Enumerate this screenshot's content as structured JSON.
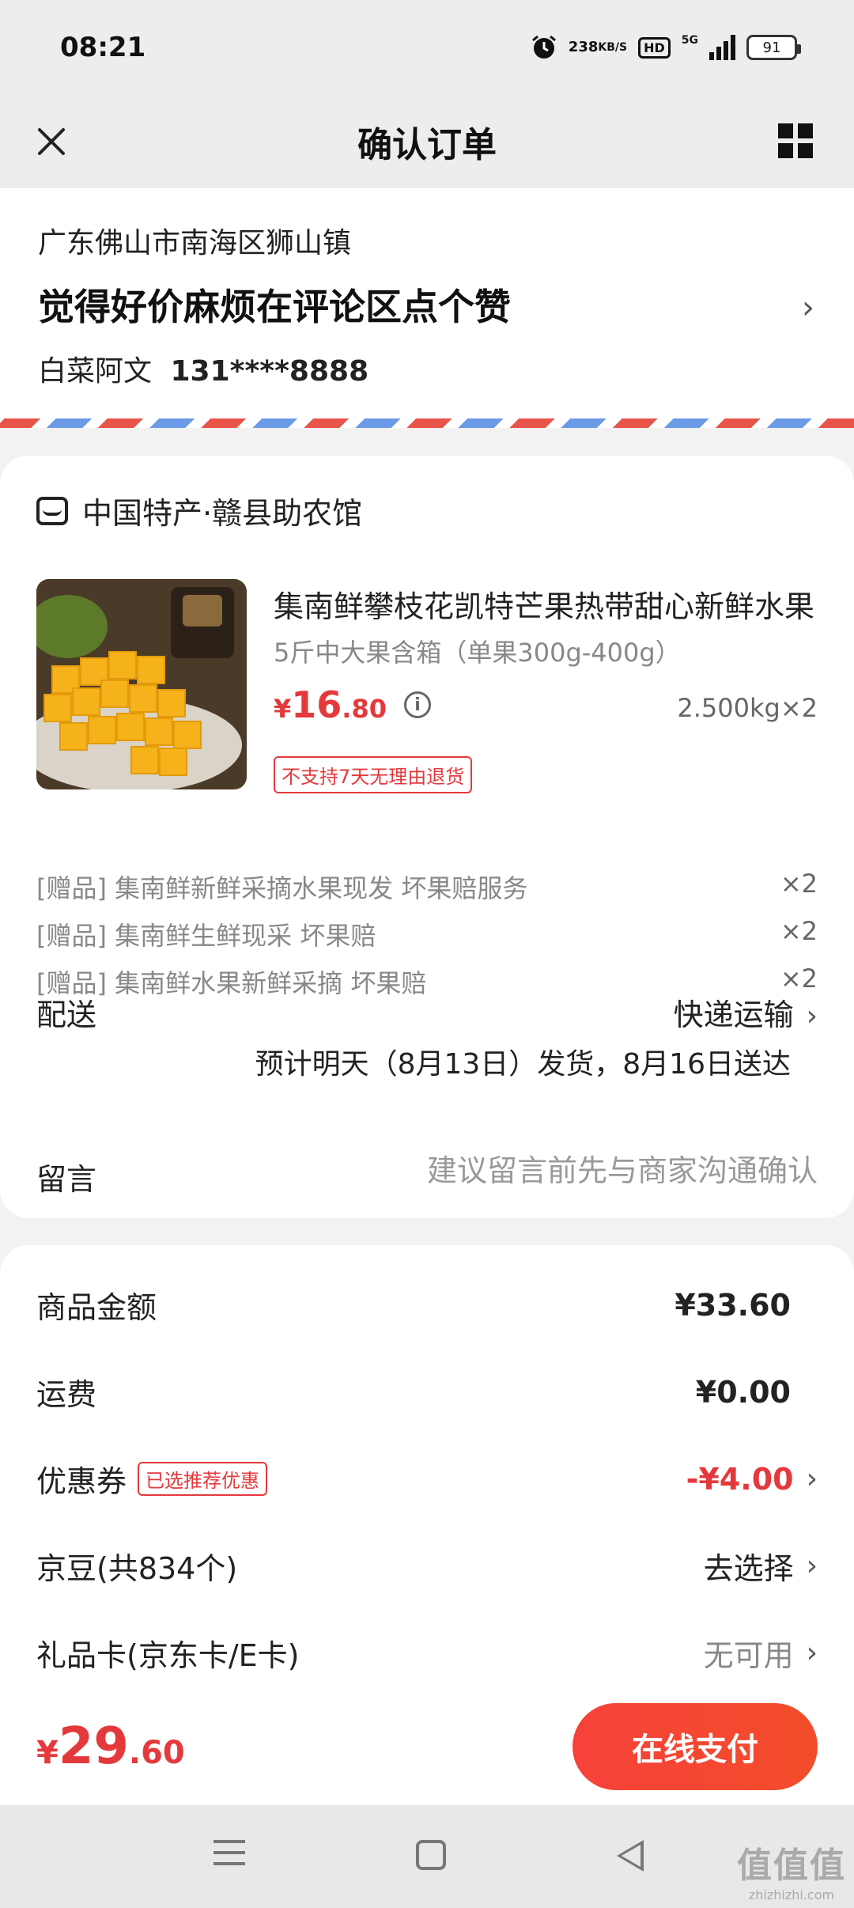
{
  "status_bar": {
    "time": "08:21",
    "net_speed_value": "238",
    "net_speed_unit": "KB/S",
    "hd": "HD",
    "network": "5G",
    "battery": "91"
  },
  "header": {
    "title": "确认订单"
  },
  "address": {
    "region": "广东佛山市南海区狮山镇",
    "detail": "觉得好价麻烦在评论区点个赞",
    "name": "白菜阿文",
    "phone": "131****8888"
  },
  "store": {
    "name": "中国特产·赣县助农馆"
  },
  "product": {
    "title": "集南鲜攀枝花凯特芒果热带甜心新鲜水果",
    "spec": "5斤中大果含箱（单果300g-400g）",
    "price_currency": "¥",
    "price_int": "16",
    "price_dec": ".80",
    "quantity": "2.500kg×2",
    "return_policy": "不支持7天无理由退货"
  },
  "gifts": [
    {
      "tag": "[赠品]",
      "name": "集南鲜新鲜采摘水果现发 坏果赔服务",
      "qty": "×2"
    },
    {
      "tag": "[赠品]",
      "name": "集南鲜生鲜现采 坏果赔",
      "qty": "×2"
    },
    {
      "tag": "[赠品]",
      "name": "集南鲜水果新鲜采摘 坏果赔",
      "qty": "×2"
    }
  ],
  "delivery": {
    "label": "配送",
    "method": "快递运输",
    "estimate": "预计明天（8月13日）发货，8月16日送达"
  },
  "note": {
    "label": "留言",
    "placeholder": "建议留言前先与商家沟通确认"
  },
  "summary": {
    "goods_label": "商品金额",
    "goods_value": "¥33.60",
    "shipping_label": "运费",
    "shipping_value": "¥0.00",
    "coupon_label": "优惠券",
    "coupon_tag": "已选推荐优惠",
    "coupon_value": "-¥4.00",
    "jingdou_label": "京豆(共834个)",
    "jingdou_value": "去选择",
    "giftcard_label": "礼品卡(京东卡/E卡)",
    "giftcard_value": "无可用"
  },
  "pay": {
    "currency": "¥",
    "total_int": "29",
    "total_dec": ".60",
    "button": "在线支付"
  },
  "watermark": {
    "big": "值值值",
    "small": "zhizhizhi.com"
  },
  "colors": {
    "accent_red": "#e4393c",
    "pay_button": "#f7413a",
    "background": "#f2f2f2"
  }
}
